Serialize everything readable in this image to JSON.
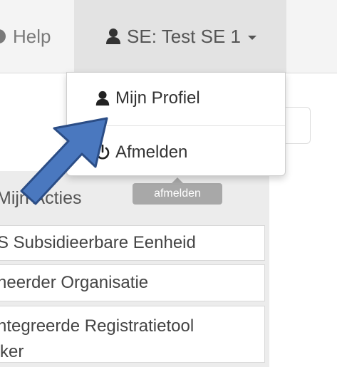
{
  "navbar": {
    "help_label": "Help",
    "help_icon": "help-circle-icon",
    "user_label": "SE: Test SE 1",
    "user_icon": "user-icon",
    "caret_icon": "caret-down-icon"
  },
  "dropdown": {
    "items": [
      {
        "label": "Mijn Profiel",
        "icon": "user-icon"
      },
      {
        "label": "Afmelden",
        "icon": "power-icon"
      }
    ]
  },
  "tooltip": {
    "text": "afmelden"
  },
  "list": {
    "header": "Mijn Acties",
    "items": [
      "S Subsidieerbare Eenheid",
      "heerder Organisatie",
      "ntegreerde Registratietool\nker"
    ]
  },
  "annotation": {
    "arrow_color": "#4a78bf",
    "arrow_stroke": "#2b4d86"
  },
  "colors": {
    "navbar_bg": "#f4f4f4",
    "active_nav_bg": "#e3e3e3",
    "tooltip_bg": "#a8a8a8"
  }
}
